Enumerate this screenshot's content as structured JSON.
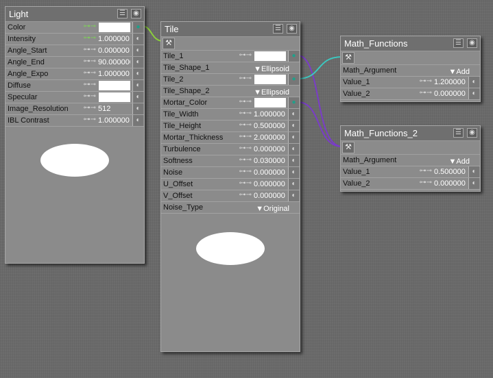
{
  "colors": {
    "wire_green": "#8ccf3c",
    "wire_purple": "#7a3cc8",
    "wire_teal": "#3cc8c0"
  },
  "nodes": [
    {
      "id": "light",
      "title": "Light",
      "tool": false,
      "rows": [
        {
          "label": "Color",
          "type": "color",
          "linked": true,
          "connected": true
        },
        {
          "label": "Intensity",
          "type": "num",
          "value": "1.000000",
          "linked": true
        },
        {
          "label": "Angle_Start",
          "type": "num",
          "value": "0.000000"
        },
        {
          "label": "Angle_End",
          "type": "num",
          "value": "90.000000"
        },
        {
          "label": "Angle_Expo",
          "type": "num",
          "value": "1.000000"
        },
        {
          "label": "Diffuse",
          "type": "color"
        },
        {
          "label": "Specular",
          "type": "color"
        },
        {
          "label": "Image_Resolution",
          "type": "num",
          "value": "512"
        },
        {
          "label": "IBL Contrast",
          "type": "num",
          "value": "1.000000"
        }
      ]
    },
    {
      "id": "tile",
      "title": "Tile",
      "tool": true,
      "rows": [
        {
          "label": "Tile_1",
          "type": "color",
          "connected": true
        },
        {
          "label": "Tile_Shape_1",
          "type": "dd",
          "value": "Ellipsoid"
        },
        {
          "label": "Tile_2",
          "type": "color",
          "connected": true
        },
        {
          "label": "Tile_Shape_2",
          "type": "dd",
          "value": "Ellipsoid"
        },
        {
          "label": "Mortar_Color",
          "type": "color",
          "connected": true
        },
        {
          "label": "Tile_Width",
          "type": "num",
          "value": "1.000000"
        },
        {
          "label": "Tile_Height",
          "type": "num",
          "value": "0.500000"
        },
        {
          "label": "Mortar_Thickness",
          "type": "num",
          "value": "2.000000"
        },
        {
          "label": "Turbulence",
          "type": "num",
          "value": "0.000000"
        },
        {
          "label": "Softness",
          "type": "num",
          "value": "0.030000"
        },
        {
          "label": "Noise",
          "type": "num",
          "value": "0.000000"
        },
        {
          "label": "U_Offset",
          "type": "num",
          "value": "0.000000"
        },
        {
          "label": "V_Offset",
          "type": "num",
          "value": "0.000000"
        },
        {
          "label": "Noise_Type",
          "type": "dd",
          "value": "Original"
        }
      ]
    },
    {
      "id": "math1",
      "title": "Math_Functions",
      "tool": true,
      "rows": [
        {
          "label": "Math_Argument",
          "type": "dd",
          "value": "Add"
        },
        {
          "label": "Value_1",
          "type": "num",
          "value": "1.200000"
        },
        {
          "label": "Value_2",
          "type": "num",
          "value": "0.000000"
        }
      ]
    },
    {
      "id": "math2",
      "title": "Math_Functions_2",
      "tool": true,
      "rows": [
        {
          "label": "Math_Argument",
          "type": "dd",
          "value": "Add"
        },
        {
          "label": "Value_1",
          "type": "num",
          "value": "0.500000"
        },
        {
          "label": "Value_2",
          "type": "num",
          "value": "0.000000"
        }
      ]
    }
  ]
}
